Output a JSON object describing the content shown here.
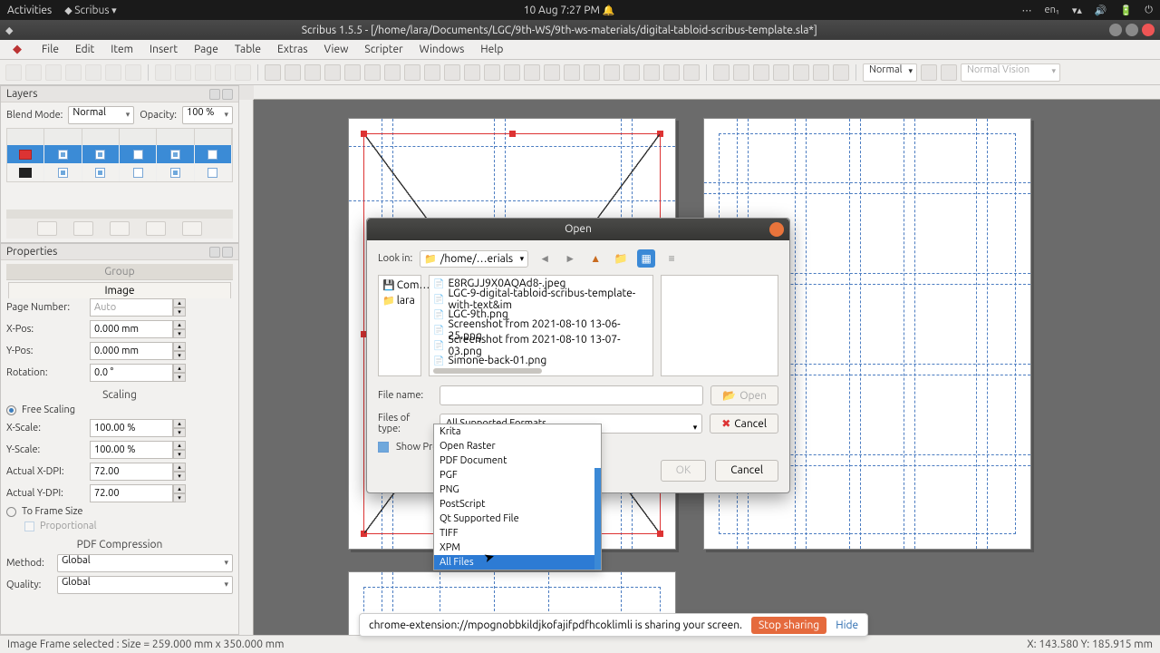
{
  "gnome": {
    "activities": "Activities",
    "app": "Scribus",
    "clock": "10 Aug   7:27 PM",
    "lang": "en₁"
  },
  "window": {
    "title": "Scribus 1.5.5 - [/home/lara/Documents/LGC/9th-WS/9th-ws-materials/digital-tabloid-scribus-template.sla*]"
  },
  "menus": [
    "File",
    "Edit",
    "Item",
    "Insert",
    "Page",
    "Table",
    "Extras",
    "View",
    "Scripter",
    "Windows",
    "Help"
  ],
  "toolbar": {
    "zoom": "Normal",
    "vis": "Normal Vision"
  },
  "layers": {
    "title": "Layers",
    "blend_label": "Blend Mode:",
    "blend": "Normal",
    "opacity_label": "Opacity:",
    "opacity": "100 %"
  },
  "props": {
    "title": "Properties",
    "group": "Group",
    "image": "Image",
    "page_number_label": "Page Number:",
    "page_number": "Auto",
    "xpos_label": "X-Pos:",
    "xpos": "0.000 mm",
    "ypos_label": "Y-Pos:",
    "ypos": "0.000 mm",
    "rotation_label": "Rotation:",
    "rotation": "0.0 °",
    "scaling": "Scaling",
    "free_scaling": "Free Scaling",
    "xscale_label": "X-Scale:",
    "xscale": "100.00 %",
    "yscale_label": "Y-Scale:",
    "yscale": "100.00 %",
    "ax_label": "Actual X-DPI:",
    "ax": "72.00",
    "ay_label": "Actual Y-DPI:",
    "ay": "72.00",
    "toframe": "To Frame Size",
    "proportional": "Proportional",
    "pdfcomp": "PDF Compression",
    "method_label": "Method:",
    "method": "Global",
    "quality_label": "Quality:",
    "quality": "Global"
  },
  "dialog": {
    "title": "Open",
    "lookin_label": "Look in:",
    "path": "/home/…erials",
    "folders": [
      "Com…",
      "lara"
    ],
    "files": [
      "E8RGJJ9X0AQAd8-.jpeg",
      "LGC-9-digital-tabloid-scribus-template-with-text&im",
      "LGC-9th.png",
      "Screenshot from 2021-08-10 13-06-25.png",
      "Screenshot from 2021-08-10 13-07-03.png",
      "Simone-back-01.png"
    ],
    "filename_label": "File name:",
    "open": "Open",
    "type_label": "Files of type:",
    "type": "All Supported Formats",
    "cancel": "Cancel",
    "show_preview": "Show Preview",
    "ok": "OK",
    "cancel2": "Cancel",
    "type_options": [
      "Krita",
      "Open Raster",
      "PDF Document",
      "PGF",
      "PNG",
      "PostScript",
      "Qt Supported File",
      "TIFF",
      "XPM",
      "All Files"
    ]
  },
  "share": {
    "text": "chrome-extension://mpognobbkildjkofajifpdfhcoklimli is sharing your screen.",
    "stop": "Stop sharing",
    "hide": "Hide"
  },
  "status": {
    "left": "Image Frame selected : Size = 259.000 mm x 350.000 mm",
    "right": "X: 143.580   Y: 185.915   mm"
  }
}
